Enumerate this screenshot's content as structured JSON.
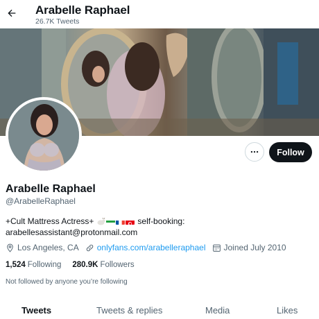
{
  "header": {
    "back_icon": "arrow-left-icon",
    "name": "Arabelle Raphael",
    "tweet_count": "26.7K Tweets"
  },
  "profile": {
    "name": "Arabelle Raphael",
    "handle": "@ArabelleRaphael",
    "bio_line1_prefix": "+Cult Mattress Actress+",
    "bio_line1_suffix": "self-booking:",
    "bio_line2": "arabellesassistant@protonmail.com",
    "location": "Los Angeles, CA",
    "website": "onlyfans.com/arabelleraphael",
    "joined": "Joined July 2010",
    "following_count": "1,524",
    "following_label": "Following",
    "followers_count": "280.9K",
    "followers_label": "Followers",
    "not_followed_text": "Not followed by anyone you’re following"
  },
  "actions": {
    "more_icon": "more-horizontal-icon",
    "follow_label": "Follow"
  },
  "tabs": [
    {
      "label": "Tweets",
      "active": true
    },
    {
      "label": "Tweets & replies",
      "active": false
    },
    {
      "label": "Media",
      "active": false
    },
    {
      "label": "Likes",
      "active": false
    }
  ],
  "colors": {
    "text": "#0f1419",
    "muted": "#536471",
    "link": "#1d9bf0",
    "button": "#0f1419"
  }
}
